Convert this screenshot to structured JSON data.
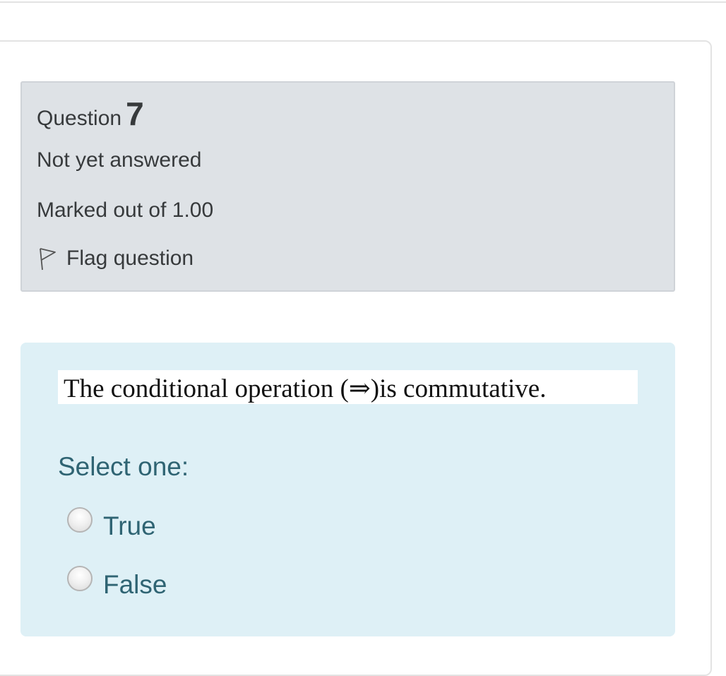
{
  "question": {
    "label": "Question",
    "number": "7",
    "state": "Not yet answered",
    "grade": "Marked out of 1.00",
    "flag_label": "Flag question",
    "flag_icon": "flag-outline-icon"
  },
  "content": {
    "text": "The conditional operation (⇒)is commutative.",
    "prompt": "Select one:",
    "options": [
      {
        "label": "True",
        "selected": false
      },
      {
        "label": "False",
        "selected": false
      }
    ]
  },
  "colors": {
    "info_background": "#dee2e6",
    "content_background": "#def0f6",
    "answer_text": "#2f6473",
    "info_text": "#373a3c"
  }
}
